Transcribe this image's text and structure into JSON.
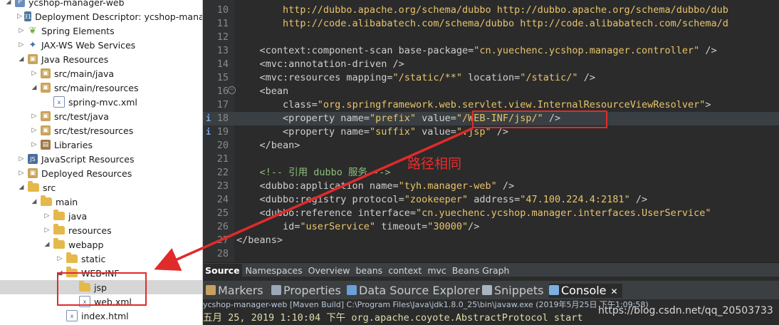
{
  "tree": {
    "items": [
      {
        "label": "ycshop-manager-web",
        "twisty": "v",
        "icon": "project",
        "indent": 0
      },
      {
        "label": "Deployment Descriptor: ycshop-mana",
        "twisty": ">",
        "icon": "desc",
        "indent": 1
      },
      {
        "label": "Spring Elements",
        "twisty": ">",
        "icon": "spring",
        "indent": 1
      },
      {
        "label": "JAX-WS Web Services",
        "twisty": ">",
        "icon": "ws",
        "indent": 1
      },
      {
        "label": "Java Resources",
        "twisty": "v",
        "icon": "pkg",
        "indent": 1
      },
      {
        "label": "src/main/java",
        "twisty": ">",
        "icon": "pkg",
        "indent": 2
      },
      {
        "label": "src/main/resources",
        "twisty": "v",
        "icon": "pkg",
        "indent": 2
      },
      {
        "label": "spring-mvc.xml",
        "twisty": "",
        "icon": "xml",
        "indent": 3
      },
      {
        "label": "src/test/java",
        "twisty": ">",
        "icon": "pkg",
        "indent": 2
      },
      {
        "label": "src/test/resources",
        "twisty": ">",
        "icon": "pkg",
        "indent": 2
      },
      {
        "label": "Libraries",
        "twisty": ">",
        "icon": "lib",
        "indent": 2
      },
      {
        "label": "JavaScript Resources",
        "twisty": ">",
        "icon": "js",
        "indent": 1
      },
      {
        "label": "Deployed Resources",
        "twisty": ">",
        "icon": "pkg",
        "indent": 1
      },
      {
        "label": "src",
        "twisty": "v",
        "icon": "folder",
        "indent": 1
      },
      {
        "label": "main",
        "twisty": "v",
        "icon": "folder",
        "indent": 2
      },
      {
        "label": "java",
        "twisty": ">",
        "icon": "folder",
        "indent": 3
      },
      {
        "label": "resources",
        "twisty": ">",
        "icon": "folder",
        "indent": 3
      },
      {
        "label": "webapp",
        "twisty": "v",
        "icon": "folder",
        "indent": 3
      },
      {
        "label": "static",
        "twisty": ">",
        "icon": "folder",
        "indent": 4
      },
      {
        "label": "WEB-INF",
        "twisty": "v",
        "icon": "folder",
        "indent": 4
      },
      {
        "label": "jsp",
        "twisty": "",
        "icon": "folder",
        "indent": 5,
        "selected": true
      },
      {
        "label": "web.xml",
        "twisty": "",
        "icon": "xml",
        "indent": 5
      },
      {
        "label": "index.html",
        "twisty": "",
        "icon": "xml",
        "indent": 4
      }
    ]
  },
  "editor": {
    "lines": [
      {
        "n": "10",
        "text": "        http://dubbo.apache.org/schema/dubbo http://dubbo.apache.org/schema/dubbo/dub",
        "kind": "url"
      },
      {
        "n": "11",
        "text": "        http://code.alibabatech.com/schema/dubbo http://code.alibabatech.com/schema/d",
        "kind": "url"
      },
      {
        "n": "12",
        "text": "",
        "kind": "plain"
      },
      {
        "n": "13",
        "pre": "    <context:component-scan base-package=",
        "val": "\"cn.yuechenc.ycshop.manager.controller\"",
        "post": " />",
        "kind": "mix"
      },
      {
        "n": "14",
        "pre": "    <mvc:annotation-driven />",
        "val": "",
        "post": "",
        "kind": "mix"
      },
      {
        "n": "15",
        "pre": "    <mvc:resources mapping=",
        "val": "\"/static/**\"",
        "post": " location=",
        "val2": "\"/static/\"",
        "post2": " />",
        "kind": "mix2"
      },
      {
        "n": "16",
        "pre": "    <bean",
        "val": "",
        "post": "",
        "kind": "mix",
        "fold": true
      },
      {
        "n": "17",
        "pre": "        class=",
        "val": "\"org.springframework.web.servlet.view.InternalResourceViewResolver\"",
        "post": ">",
        "kind": "mix"
      },
      {
        "n": "18",
        "pre": "        <property name=",
        "val": "\"prefix\"",
        "post": " value=",
        "val2": "\"/WEB-INF/jsp/\"",
        "post2": " />",
        "kind": "mix2",
        "current": true,
        "marker": true
      },
      {
        "n": "19",
        "pre": "        <property name=",
        "val": "\"suffix\"",
        "post": " value=",
        "val2": "\".jsp\"",
        "post2": " />",
        "kind": "mix2",
        "marker": true
      },
      {
        "n": "20",
        "pre": "    </bean>",
        "val": "",
        "post": "",
        "kind": "mix"
      },
      {
        "n": "21",
        "text": "",
        "kind": "plain"
      },
      {
        "n": "22",
        "text": "    <!-- 引用 dubbo 服务 -->",
        "kind": "cmt"
      },
      {
        "n": "23",
        "pre": "    <dubbo:application name=",
        "val": "\"tyh.manager-web\"",
        "post": " />",
        "kind": "mix"
      },
      {
        "n": "24",
        "pre": "    <dubbo:registry protocol=",
        "val": "\"zookeeper\"",
        "post": " address=",
        "val2": "\"47.100.224.4:2181\"",
        "post2": " />",
        "kind": "mix2"
      },
      {
        "n": "25",
        "pre": "    <dubbo:reference interface=",
        "val": "\"cn.yuechenc.ycshop.manager.interfaces.UserService\"",
        "post": "",
        "kind": "mix"
      },
      {
        "n": "26",
        "pre": "        id=",
        "val": "\"userService\"",
        "post": " timeout=",
        "val2": "\"30000\"",
        "post2": "/>",
        "kind": "mix2"
      },
      {
        "n": "27",
        "pre": "</beans>",
        "val": "",
        "post": "",
        "kind": "mix"
      },
      {
        "n": "28",
        "text": "",
        "kind": "plain"
      }
    ],
    "annotation": "路径相同"
  },
  "editor_tabs": [
    "Source",
    "Namespaces",
    "Overview",
    "beans",
    "context",
    "mvc",
    "Beans Graph"
  ],
  "views": [
    {
      "label": "Markers",
      "icon": "markers-icon"
    },
    {
      "label": "Properties",
      "icon": "properties-icon"
    },
    {
      "label": "Data Source Explorer",
      "icon": "datasource-icon"
    },
    {
      "label": "Snippets",
      "icon": "snippets-icon"
    },
    {
      "label": "Console",
      "icon": "console-icon",
      "active": true,
      "close": "✕"
    }
  ],
  "console": {
    "header": "ycshop-manager-web [Maven Build] C:\\Program Files\\Java\\jdk1.8.0_25\\bin\\javaw.exe (2019年5月25日 下午1:09:58)",
    "line": "五月 25, 2019 1:10:04 下午 org.apache.coyote.AbstractProtocol start"
  },
  "watermark": "https://blog.csdn.net/qq_20503733",
  "colors": {
    "highlight": "#e12a2a",
    "string": "#e8c46b",
    "comment": "#8dbf7a"
  }
}
